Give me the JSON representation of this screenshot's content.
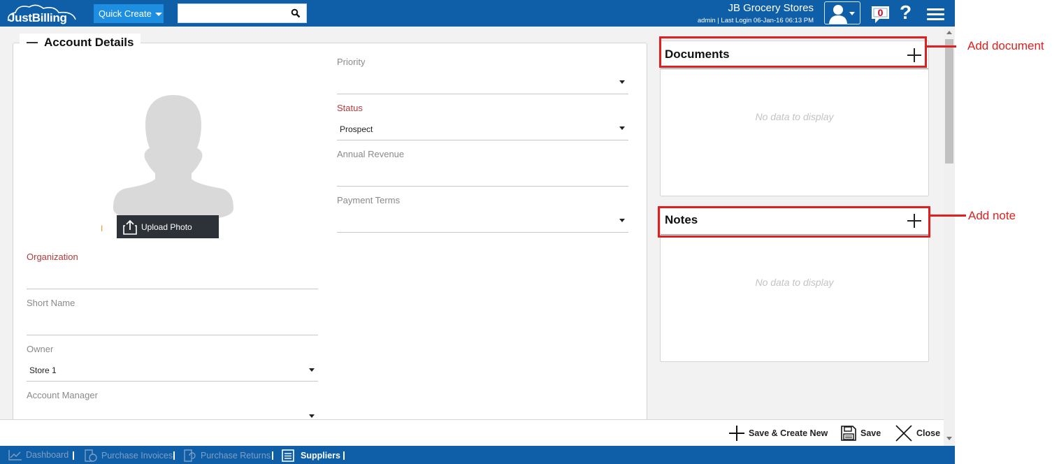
{
  "header": {
    "logo_text": "JustBilling",
    "quick_create_label": "Quick Create",
    "search_value": "",
    "store_name": "JB Grocery Stores",
    "login_info": "admin | Last Login 06-Jan-16 06:13 PM",
    "notification_count": "0",
    "help_label": "?"
  },
  "account_panel": {
    "title": "Account Details",
    "upload_marker": "I",
    "upload_label": "Upload Photo",
    "left_fields": [
      {
        "label": "Organization",
        "value": ""
      },
      {
        "label": "Short Name",
        "value": ""
      },
      {
        "label": "Owner",
        "value": "Store 1"
      },
      {
        "label": "Account Manager",
        "value": ""
      }
    ],
    "right_fields": [
      {
        "label": "Priority",
        "value": ""
      },
      {
        "label": "Status",
        "value": "Prospect"
      },
      {
        "label": "Annual Revenue",
        "value": ""
      },
      {
        "label": "Payment Terms",
        "value": ""
      }
    ]
  },
  "documents": {
    "title": "Documents",
    "empty_text": "No data to display"
  },
  "notes": {
    "title": "Notes",
    "empty_text": "No data to display"
  },
  "actions": {
    "save_new_label": "Save & Create New",
    "save_label": "Save",
    "close_label": "Close"
  },
  "bottom_nav": {
    "items": [
      {
        "label": "Dashboard"
      },
      {
        "label": "Purchase Invoices"
      },
      {
        "label": "Purchase Returns"
      },
      {
        "label": "Suppliers"
      }
    ]
  },
  "annotations": {
    "add_document": "Add document",
    "add_note": "Add note"
  },
  "colors": {
    "brand": "#0f5ea8",
    "accent": "#1e8ee0",
    "required_label": "#b33a3a",
    "annotation": "#e02020"
  }
}
